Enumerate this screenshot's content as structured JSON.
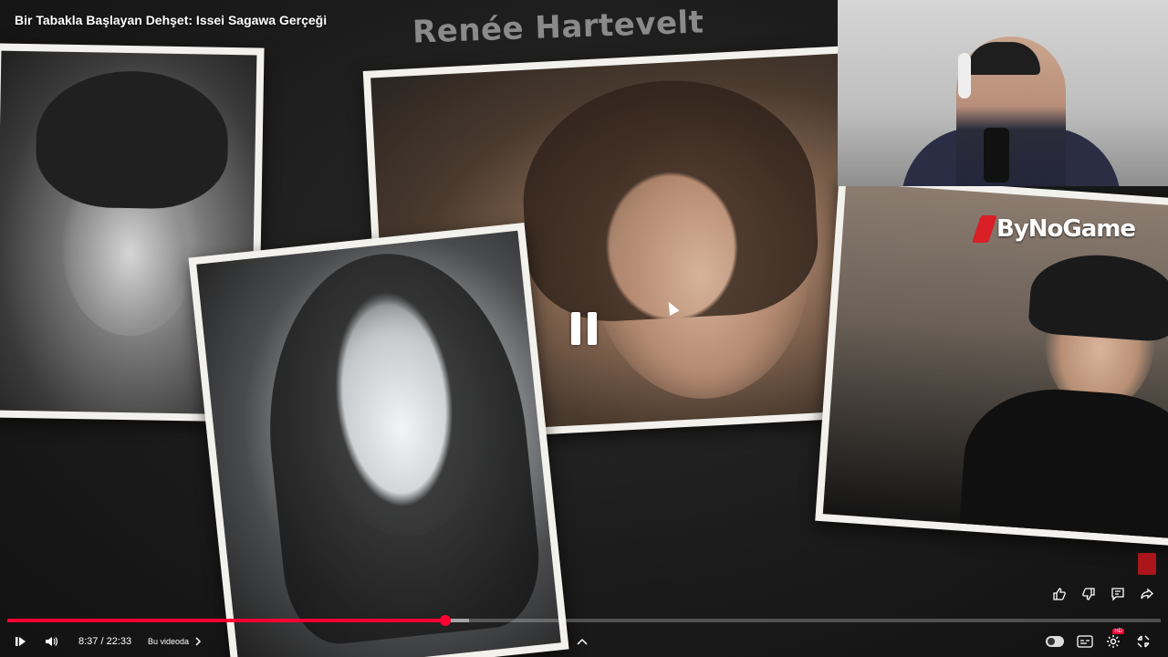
{
  "video": {
    "title": "Bir Tabakla Başlayan Dehşet: Issei Sagawa Gerçeği",
    "overlay_title": "Renée Hartevelt",
    "channel_logo_text": "ByNoGame",
    "state": "playing"
  },
  "player": {
    "current_time": "8:37",
    "duration": "22:33",
    "time_separator": "/",
    "chapter_label": "Bu videoda",
    "progress_played_fraction": 0.38,
    "progress_buffered_fraction": 0.4
  },
  "colors": {
    "accent": "#ff0033",
    "logo_red": "#d81f26"
  },
  "icons": {
    "side_actions": [
      "thumbs-up-icon",
      "thumbs-down-icon",
      "comment-icon",
      "share-icon"
    ],
    "controls_left": [
      "play-pause-icon",
      "volume-icon"
    ],
    "controls_right": [
      "autoplay-toggle-icon",
      "subtitles-icon",
      "settings-icon",
      "exit-fullscreen-icon"
    ]
  },
  "settings_badge": "HD"
}
